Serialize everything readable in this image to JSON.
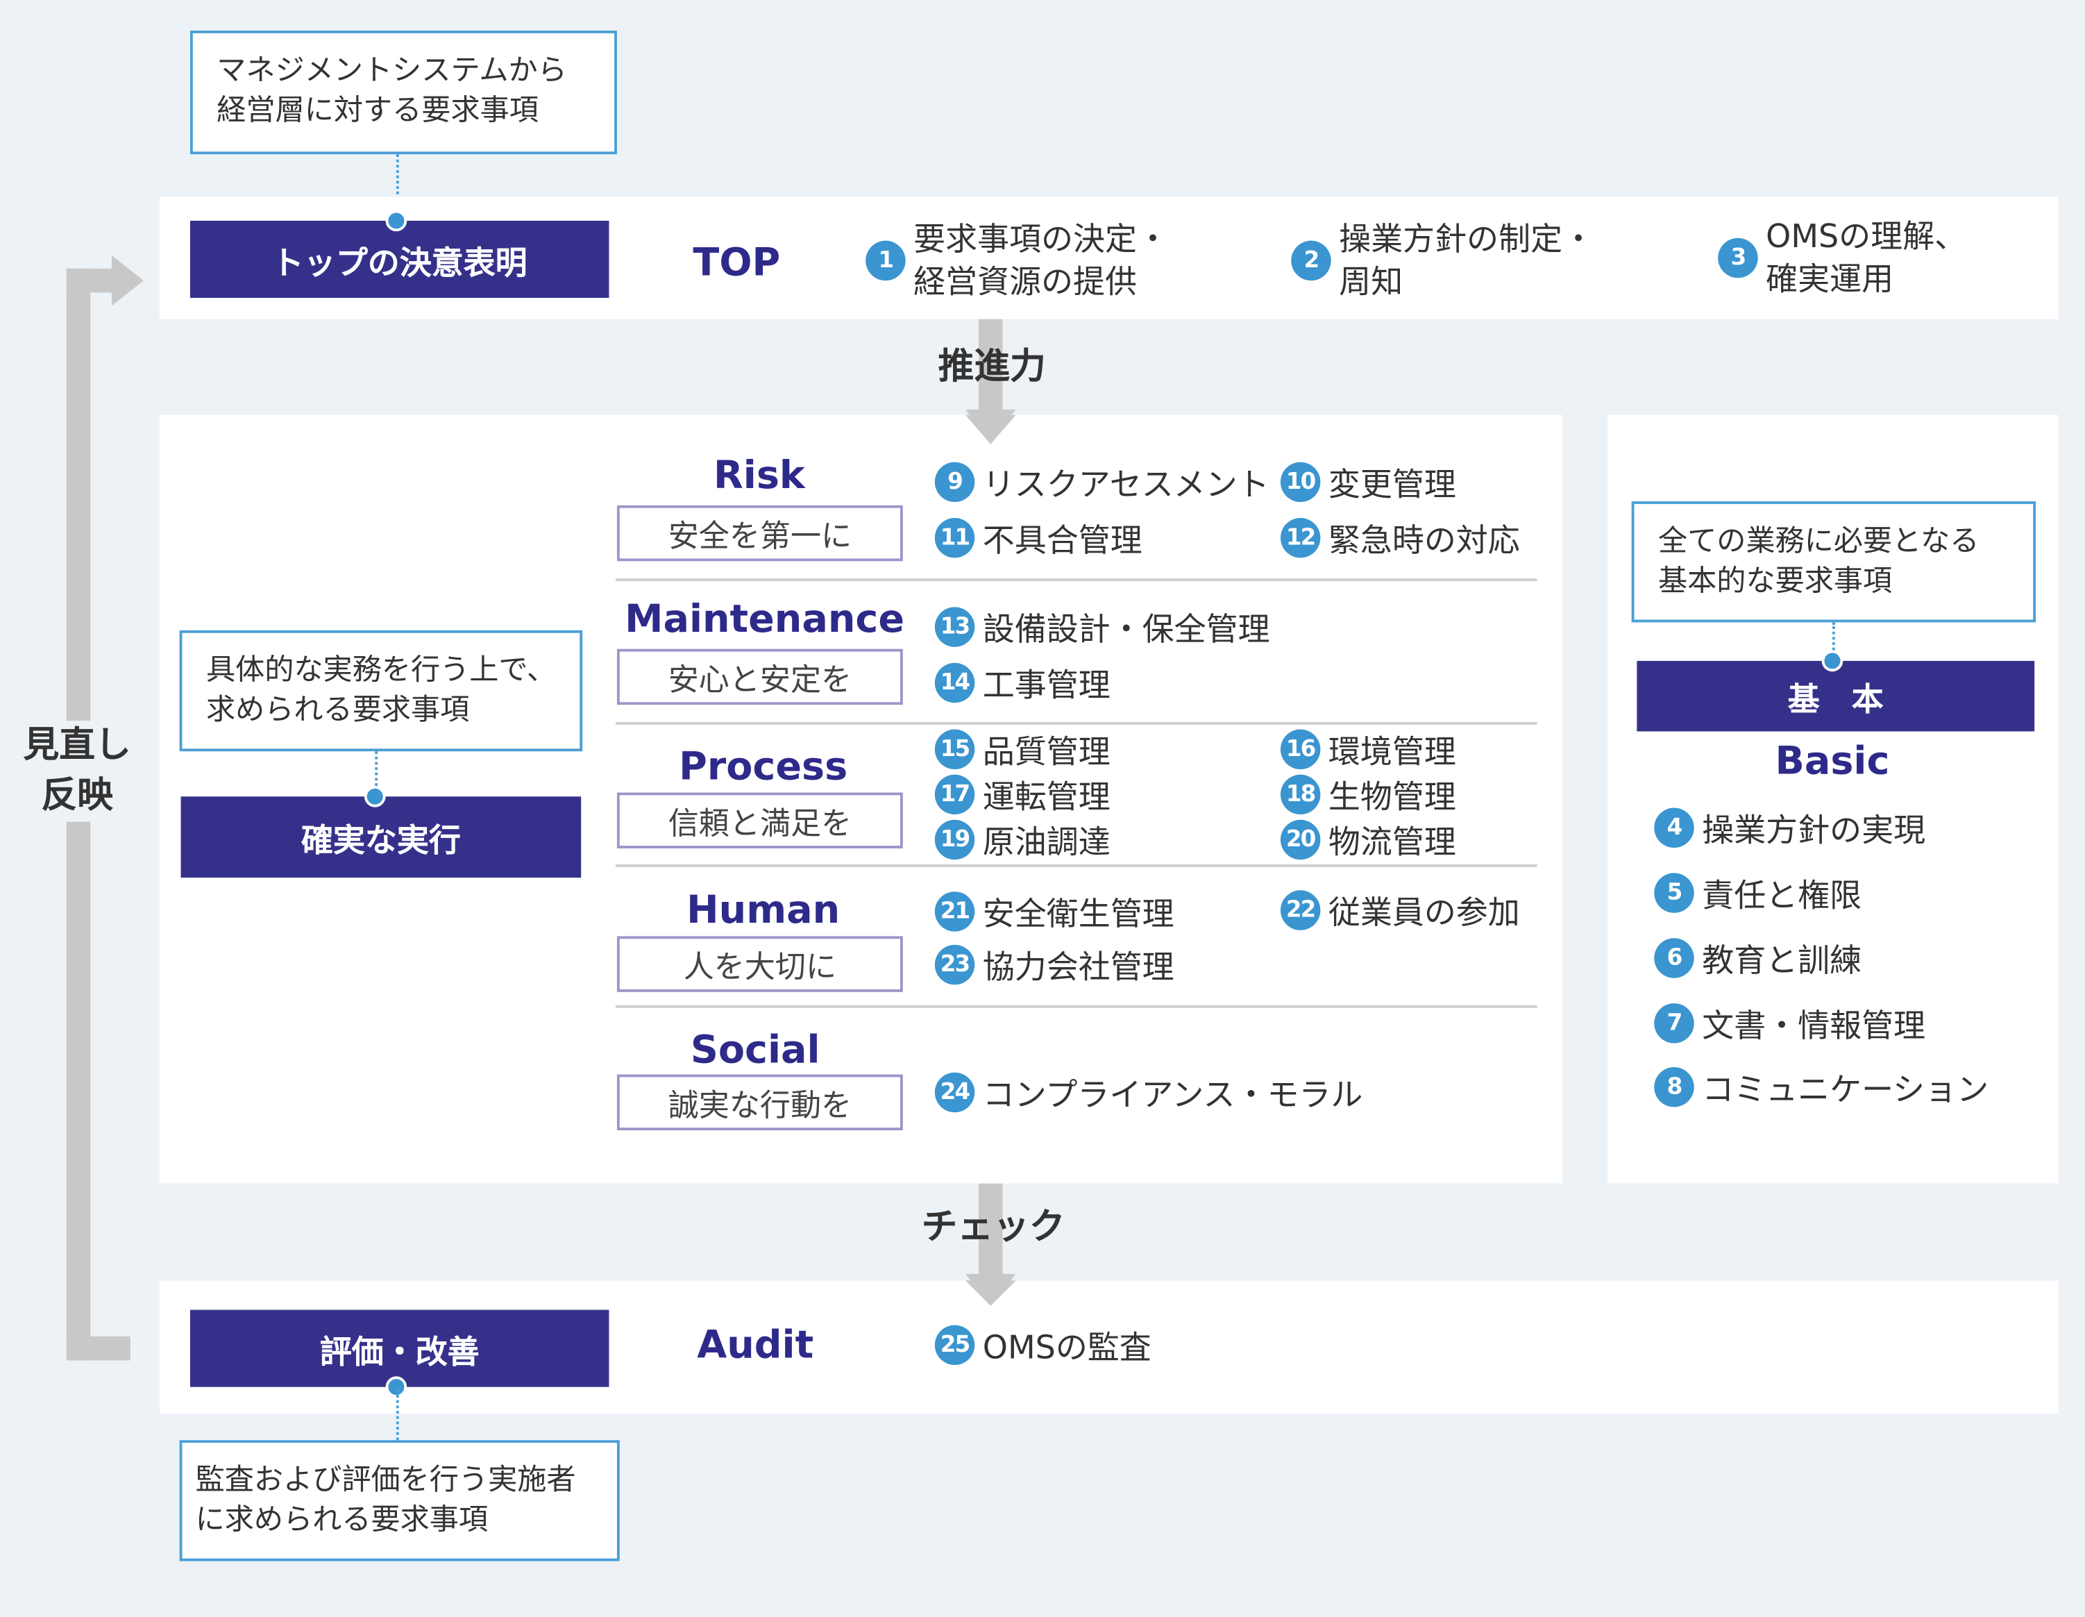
{
  "colors": {
    "navy": "#35318a",
    "accent_blue": "#3a95d0",
    "label_navy": "#2e2a8a",
    "arrow_gray": "#c8c8c8",
    "background": "#edf2f7"
  },
  "top": {
    "callout": [
      "マネジメントシステムから",
      "経営層に対する要求事項"
    ],
    "box": "トップの決意表明",
    "label": "TOP",
    "items": [
      {
        "num": "1",
        "lines": [
          "要求事項の決定・",
          "経営資源の提供"
        ]
      },
      {
        "num": "2",
        "lines": [
          "操業方針の制定・",
          "周知"
        ]
      },
      {
        "num": "3",
        "lines": [
          "OMSの理解、",
          "確実運用"
        ]
      }
    ]
  },
  "arrow_down_1": "推進力",
  "feedback": [
    "見直し",
    "反映"
  ],
  "execution": {
    "callout": [
      "具体的な実務を行う上で、",
      "求められる要求事項"
    ],
    "box": "確実な実行",
    "categories": [
      {
        "title": "Risk",
        "subtitle": "安全を第一に",
        "items": [
          {
            "num": "9",
            "text": "リスクアセスメント"
          },
          {
            "num": "10",
            "text": "変更管理"
          },
          {
            "num": "11",
            "text": "不具合管理"
          },
          {
            "num": "12",
            "text": "緊急時の対応"
          }
        ]
      },
      {
        "title": "Maintenance",
        "subtitle": "安心と安定を",
        "items": [
          {
            "num": "13",
            "text": "設備設計・保全管理"
          },
          {
            "num": "14",
            "text": "工事管理"
          }
        ]
      },
      {
        "title": "Process",
        "subtitle": "信頼と満足を",
        "items": [
          {
            "num": "15",
            "text": "品質管理"
          },
          {
            "num": "16",
            "text": "環境管理"
          },
          {
            "num": "17",
            "text": "運転管理"
          },
          {
            "num": "18",
            "text": "生物管理"
          },
          {
            "num": "19",
            "text": "原油調達"
          },
          {
            "num": "20",
            "text": "物流管理"
          }
        ]
      },
      {
        "title": "Human",
        "subtitle": "人を大切に",
        "items": [
          {
            "num": "21",
            "text": "安全衛生管理"
          },
          {
            "num": "22",
            "text": "従業員の参加"
          },
          {
            "num": "23",
            "text": "協力会社管理"
          }
        ]
      },
      {
        "title": "Social",
        "subtitle": "誠実な行動を",
        "items": [
          {
            "num": "24",
            "text": "コンプライアンス・モラル"
          }
        ]
      }
    ]
  },
  "basic": {
    "callout": [
      "全ての業務に必要となる",
      "基本的な要求事項"
    ],
    "box": "基　本",
    "label": "Basic",
    "items": [
      {
        "num": "4",
        "text": "操業方針の実現"
      },
      {
        "num": "5",
        "text": "責任と権限"
      },
      {
        "num": "6",
        "text": "教育と訓練"
      },
      {
        "num": "7",
        "text": "文書・情報管理"
      },
      {
        "num": "8",
        "text": "コミュニケーション"
      }
    ]
  },
  "arrow_down_2": "チェック",
  "audit": {
    "box": "評価・改善",
    "label": "Audit",
    "item": {
      "num": "25",
      "text": "OMSの監査"
    },
    "callout": [
      "監査および評価を行う実施者",
      "に求められる要求事項"
    ]
  }
}
